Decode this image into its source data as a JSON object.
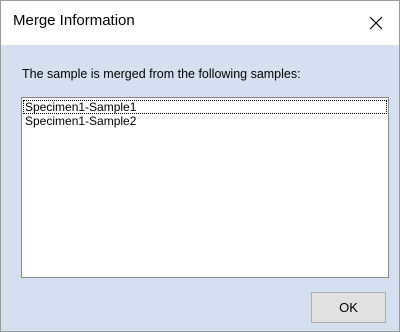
{
  "dialog": {
    "title": "Merge Information",
    "close_icon": "close-icon",
    "message": "The sample is merged from the following samples:",
    "samples": [
      "Specimen1-Sample1",
      "Specimen1-Sample2"
    ],
    "ok_label": "OK"
  },
  "colors": {
    "dialog_background": "#d4e0ef",
    "titlebar_background": "#ffffff",
    "button_background": "#e1e1e1"
  }
}
